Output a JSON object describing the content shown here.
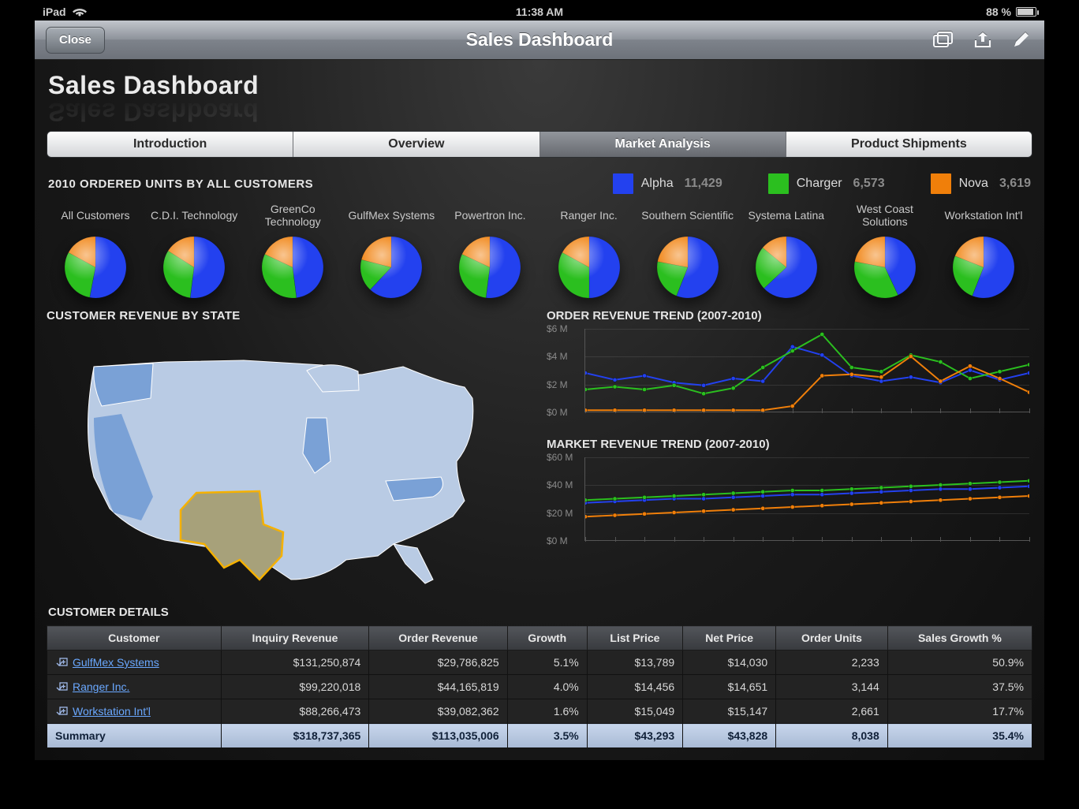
{
  "status": {
    "device": "iPad",
    "time": "11:38 AM",
    "battery_pct": "88 %"
  },
  "toolbar": {
    "close": "Close",
    "title": "Sales Dashboard"
  },
  "page": {
    "title": "Sales Dashboard"
  },
  "tabs": [
    {
      "label": "Introduction",
      "active": false
    },
    {
      "label": "Overview",
      "active": false
    },
    {
      "label": "Market Analysis",
      "active": true
    },
    {
      "label": "Product Shipments",
      "active": false
    }
  ],
  "ordered_units": {
    "title": "2010 ORDERED UNITS BY ALL CUSTOMERS",
    "legend": [
      {
        "name": "Alpha",
        "value": "11,429",
        "color": "#2341ef"
      },
      {
        "name": "Charger",
        "value": "6,573",
        "color": "#2bbf1f"
      },
      {
        "name": "Nova",
        "value": "3,619",
        "color": "#f07f0a"
      }
    ],
    "customers": [
      {
        "name": "All Customers",
        "alpha": 53,
        "charger": 30,
        "nova": 17
      },
      {
        "name": "C.D.I. Technology",
        "alpha": 52,
        "charger": 32,
        "nova": 16
      },
      {
        "name": "GreenCo Technology",
        "alpha": 48,
        "charger": 34,
        "nova": 18
      },
      {
        "name": "GulfMex Systems",
        "alpha": 62,
        "charger": 17,
        "nova": 21
      },
      {
        "name": "Powertron Inc.",
        "alpha": 52,
        "charger": 30,
        "nova": 18
      },
      {
        "name": "Ranger Inc.",
        "alpha": 50,
        "charger": 33,
        "nova": 17
      },
      {
        "name": "Southern Scientific",
        "alpha": 56,
        "charger": 22,
        "nova": 22
      },
      {
        "name": "Systema Latina",
        "alpha": 63,
        "charger": 23,
        "nova": 14
      },
      {
        "name": "West Coast Solutions",
        "alpha": 43,
        "charger": 35,
        "nova": 22
      },
      {
        "name": "Workstation Int'l",
        "alpha": 56,
        "charger": 25,
        "nova": 19
      }
    ]
  },
  "revenue_by_state": {
    "title": "CUSTOMER REVENUE BY STATE",
    "selected_state": "Texas",
    "highlighted_states": [
      "WA",
      "CA",
      "IL",
      "TX",
      "NC"
    ]
  },
  "order_trend": {
    "title": "ORDER REVENUE TREND (2007-2010)"
  },
  "market_trend": {
    "title": "MARKET REVENUE TREND (2007-2010)"
  },
  "customer_details": {
    "title": "CUSTOMER DETAILS",
    "columns": [
      "Customer",
      "Inquiry Revenue",
      "Order Revenue",
      "Growth",
      "List Price",
      "Net Price",
      "Order Units",
      "Sales Growth %"
    ],
    "rows": [
      {
        "customer": "GulfMex Systems",
        "inquiry": "$131,250,874",
        "order": "$29,786,825",
        "growth": "5.1%",
        "list": "$13,789",
        "net": "$14,030",
        "units": "2,233",
        "sg": "50.9%"
      },
      {
        "customer": "Ranger Inc.",
        "inquiry": "$99,220,018",
        "order": "$44,165,819",
        "growth": "4.0%",
        "list": "$14,456",
        "net": "$14,651",
        "units": "3,144",
        "sg": "37.5%"
      },
      {
        "customer": "Workstation Int'l",
        "inquiry": "$88,266,473",
        "order": "$39,082,362",
        "growth": "1.6%",
        "list": "$15,049",
        "net": "$15,147",
        "units": "2,661",
        "sg": "17.7%"
      }
    ],
    "summary": {
      "label": "Summary",
      "inquiry": "$318,737,365",
      "order": "$113,035,006",
      "growth": "3.5%",
      "list": "$43,293",
      "net": "$43,828",
      "units": "8,038",
      "sg": "35.4%"
    }
  },
  "chart_data": [
    {
      "type": "line",
      "title": "ORDER REVENUE TREND (2007-2010)",
      "ylabel": "$ M",
      "ylim": [
        0,
        6
      ],
      "yticks": [
        "$0 M",
        "$2 M",
        "$4 M",
        "$6 M"
      ],
      "x_count": 16,
      "series": [
        {
          "name": "Alpha",
          "color": "#2341ef",
          "values": [
            2.8,
            2.3,
            2.6,
            2.1,
            1.9,
            2.4,
            2.2,
            4.7,
            4.1,
            2.6,
            2.2,
            2.5,
            2.1,
            3.0,
            2.3,
            2.8
          ]
        },
        {
          "name": "Charger",
          "color": "#2bbf1f",
          "values": [
            1.6,
            1.8,
            1.6,
            1.9,
            1.3,
            1.7,
            3.2,
            4.4,
            5.6,
            3.2,
            2.9,
            4.1,
            3.6,
            2.4,
            2.9,
            3.4
          ]
        },
        {
          "name": "Nova",
          "color": "#f07f0a",
          "values": [
            0.1,
            0.1,
            0.1,
            0.1,
            0.1,
            0.1,
            0.1,
            0.4,
            2.6,
            2.7,
            2.5,
            4.0,
            2.2,
            3.3,
            2.4,
            1.4
          ]
        }
      ]
    },
    {
      "type": "line",
      "title": "MARKET REVENUE TREND (2007-2010)",
      "ylabel": "$ M",
      "ylim": [
        0,
        60
      ],
      "yticks": [
        "$0 M",
        "$20 M",
        "$40 M",
        "$60 M"
      ],
      "x_count": 16,
      "series": [
        {
          "name": "Alpha",
          "color": "#2341ef",
          "values": [
            27,
            28,
            29,
            30,
            30,
            31,
            32,
            33,
            33,
            34,
            35,
            36,
            37,
            37,
            38,
            39
          ]
        },
        {
          "name": "Charger",
          "color": "#2bbf1f",
          "values": [
            29,
            30,
            31,
            32,
            33,
            34,
            35,
            36,
            36,
            37,
            38,
            39,
            40,
            41,
            42,
            43
          ]
        },
        {
          "name": "Nova",
          "color": "#f07f0a",
          "values": [
            17,
            18,
            19,
            20,
            21,
            22,
            23,
            24,
            25,
            26,
            27,
            28,
            29,
            30,
            31,
            32
          ]
        }
      ]
    }
  ],
  "colors": {
    "alpha": "#2341ef",
    "charger": "#2bbf1f",
    "nova": "#f07f0a"
  }
}
